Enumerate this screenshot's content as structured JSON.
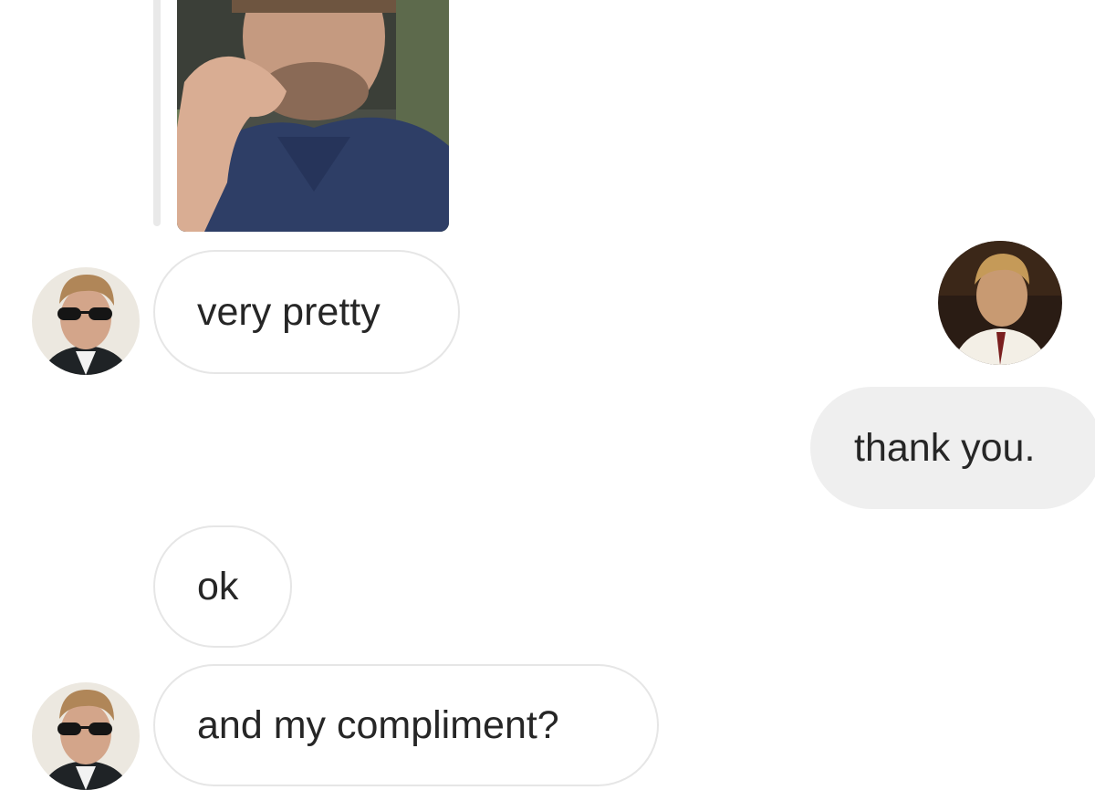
{
  "conversation": {
    "messages": [
      {
        "sender": "other",
        "type": "image",
        "image": "man-thinking-photo"
      },
      {
        "sender": "other",
        "type": "text",
        "text": "very pretty"
      },
      {
        "sender": "me",
        "type": "text",
        "text": "thank you."
      },
      {
        "sender": "other",
        "type": "text",
        "text": "ok"
      },
      {
        "sender": "other",
        "type": "text",
        "text": "and my compliment?"
      }
    ]
  },
  "colors": {
    "background": "#ffffff",
    "received_bubble": "#ffffff",
    "received_border": "#e6e6e6",
    "sent_bubble": "#efefef",
    "text": "#262626"
  }
}
